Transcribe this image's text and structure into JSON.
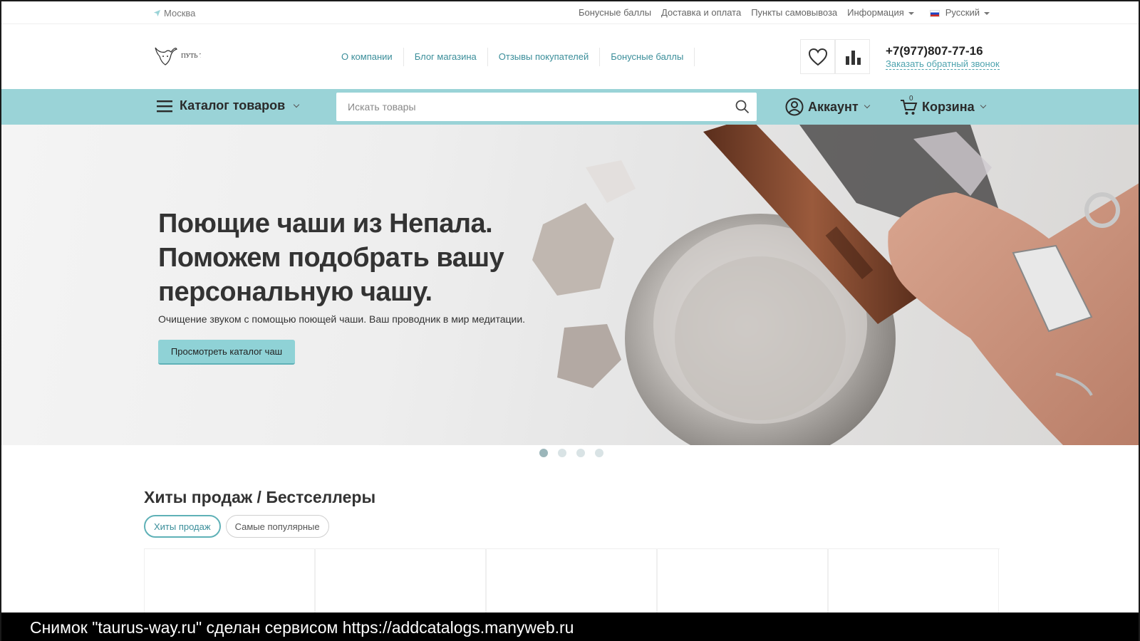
{
  "topbar": {
    "city": "Москва",
    "links": [
      "Бонусные баллы",
      "Доставка и оплата",
      "Пункты самовывоза"
    ],
    "info": "Информация",
    "language": "Русский"
  },
  "header": {
    "logo_text": "ПУТЬ ТЕЛЬЦА",
    "nav": [
      "О компании",
      "Блог магазина",
      "Отзывы покупателей",
      "Бонусные баллы"
    ],
    "phone": "+7(977)807-77-16",
    "callback": "Заказать обратный звонок"
  },
  "catbar": {
    "catalog": "Каталог товаров",
    "search_placeholder": "Искать товары",
    "account": "Аккаунт",
    "cart": "Корзина",
    "cart_count": "0"
  },
  "hero": {
    "title": "Поющие чаши из Непала. Поможем подобрать вашу персональную чашу.",
    "subtitle": "Очищение звуком с помощью поющей чаши. Ваш проводник в мир медитации.",
    "button": "Просмотреть каталог чаш",
    "slides": 4,
    "active_slide": 1
  },
  "bestsellers": {
    "title": "Хиты продаж / Бестселлеры",
    "tabs": [
      "Хиты продаж",
      "Самые популярные"
    ]
  },
  "watermark": "Снимок \"taurus-way.ru\" сделан сервисом https://addcatalogs.manyweb.ru",
  "colors": {
    "accent": "#9ad3d7",
    "link": "#3b8e9a"
  }
}
